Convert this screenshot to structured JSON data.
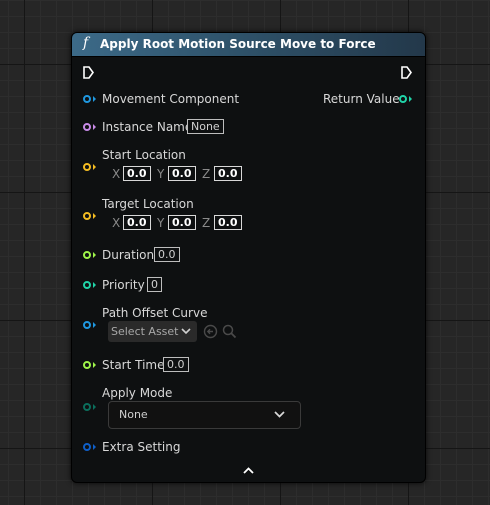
{
  "node": {
    "func_symbol": "f",
    "title": "Apply Root Motion Source Move to Force",
    "output": {
      "return_label": "Return Value"
    },
    "inputs": {
      "movement_component": "Movement Component",
      "instance_name": {
        "label": "Instance Name",
        "value": "None"
      },
      "start_location": {
        "label": "Start Location",
        "x_axis": "X",
        "x": "0.0",
        "y_axis": "Y",
        "y": "0.0",
        "z_axis": "Z",
        "z": "0.0"
      },
      "target_location": {
        "label": "Target Location",
        "x_axis": "X",
        "x": "0.0",
        "y_axis": "Y",
        "y": "0.0",
        "z_axis": "Z",
        "z": "0.0"
      },
      "duration": {
        "label": "Duration",
        "value": "0.0"
      },
      "priority": {
        "label": "Priority",
        "value": "0"
      },
      "path_offset_curve": {
        "label": "Path Offset Curve",
        "select_label": "Select Asset"
      },
      "start_time": {
        "label": "Start Time",
        "value": "0.0"
      },
      "apply_mode": {
        "label": "Apply Mode",
        "value": "None"
      },
      "extra_setting": "Extra Setting"
    },
    "pin_colors": {
      "object": "#1f98e0",
      "name": "#c88be8",
      "vector": "#f4bc22",
      "float": "#9ef44a",
      "integer": "#20d4a8",
      "enum": "#0b6e5c",
      "struct": "#0f5fc8",
      "return": "#20d4a8"
    }
  }
}
